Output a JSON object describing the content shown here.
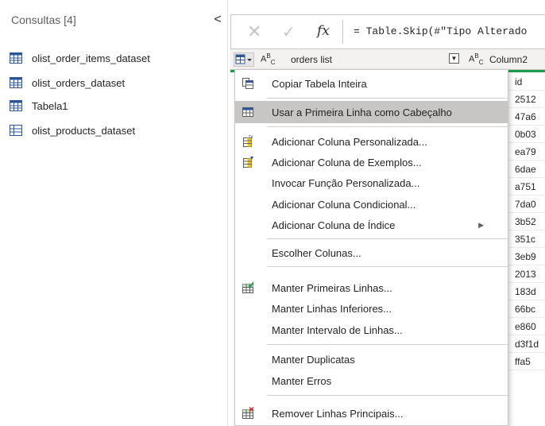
{
  "queries": {
    "header": "Consultas [4]",
    "collapse_glyph": "<",
    "items": [
      {
        "label": "olist_order_items_dataset",
        "icon": "table-icon"
      },
      {
        "label": "olist_orders_dataset",
        "icon": "table-icon"
      },
      {
        "label": "Tabela1",
        "icon": "table-icon"
      },
      {
        "label": "olist_products_dataset",
        "icon": "table-grid-icon"
      }
    ]
  },
  "formula_bar": {
    "cancel_glyph": "✕",
    "commit_glyph": "✓",
    "fx": "fx",
    "formula": "= Table.Skip(#\"Tipo Alterado"
  },
  "grid": {
    "col1_type": "ABC",
    "col1_label": "orders list",
    "col2_label": "Column2",
    "col2_cells": [
      "id",
      "2512",
      "47a6",
      "0b03",
      "ea79",
      "6dae",
      "a751",
      "7da0",
      "3b52",
      "351c",
      "3eb9",
      "2013",
      "183d",
      "66bc",
      "e860",
      "d3f1d",
      "ffa5"
    ]
  },
  "context_menu": {
    "items": [
      {
        "label": "Copiar Tabela Inteira",
        "icon": "copy-table-icon"
      },
      {
        "label": "Usar a Primeira Linha como Cabeçalho",
        "icon": "header-row-icon",
        "highlighted": true
      },
      {
        "label": "Adicionar Coluna Personalizada...",
        "icon": "custom-column-icon"
      },
      {
        "label": "Adicionar Coluna de Exemplos...",
        "icon": "column-from-examples-icon"
      },
      {
        "label": "Invocar Função Personalizada...",
        "icon": ""
      },
      {
        "label": "Adicionar Coluna Condicional...",
        "icon": ""
      },
      {
        "label": "Adicionar Coluna de Índice",
        "icon": "",
        "submenu": true
      },
      {
        "label": "Escolher Colunas...",
        "icon": ""
      },
      {
        "label": "Manter Primeiras Linhas...",
        "icon": "keep-rows-icon"
      },
      {
        "label": "Manter Linhas Inferiores...",
        "icon": ""
      },
      {
        "label": "Manter Intervalo de Linhas...",
        "icon": ""
      },
      {
        "label": "Manter Duplicatas",
        "icon": ""
      },
      {
        "label": "Manter Erros",
        "icon": ""
      },
      {
        "label": "Remover Linhas Principais...",
        "icon": "remove-rows-icon"
      }
    ]
  },
  "colors": {
    "accent_green": "#1b9e4a",
    "highlight": "#c8c6c4",
    "icon_blue": "#2b579a"
  }
}
